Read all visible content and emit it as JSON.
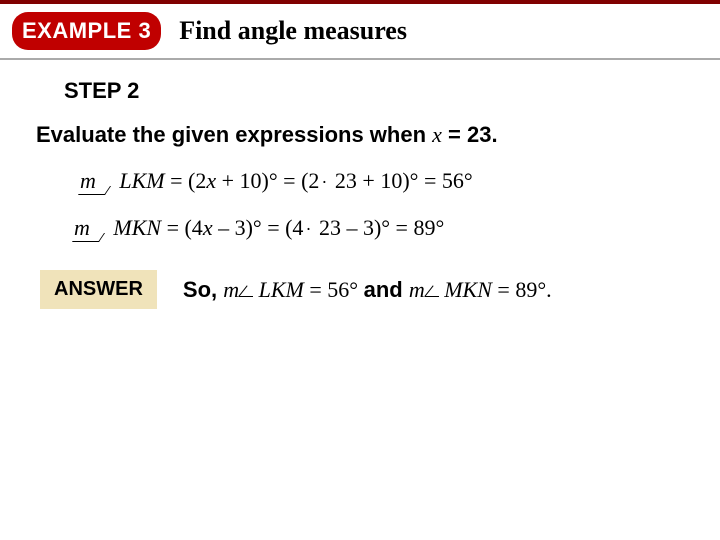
{
  "header": {
    "badge": "EXAMPLE 3",
    "title": "Find angle measures"
  },
  "step": {
    "label": "STEP 2"
  },
  "prompt": {
    "lead": "Evaluate the given expressions when ",
    "var": "x",
    "eq": " = 23."
  },
  "line1": {
    "m": "m",
    "angle": "LKM",
    "expr_open": " = (2",
    "var1": "x",
    "expr_mid": " + 10)° = (2",
    "dot": "·",
    "val": " 23 + 10)° = 56°"
  },
  "line2": {
    "m": "m",
    "angle": "MKN",
    "expr_open": " = (4",
    "var1": "x",
    "expr_mid": " – 3)° = (4",
    "dot": "·",
    "val": " 23 – 3)° = 89°"
  },
  "answer": {
    "box": "ANSWER",
    "so": "So, ",
    "m1": "m",
    "ang1": "LKM",
    "eq1": " = 56° ",
    "and": "and ",
    "m2": "m",
    "ang2": "MKN",
    "eq2": " = 89°."
  }
}
